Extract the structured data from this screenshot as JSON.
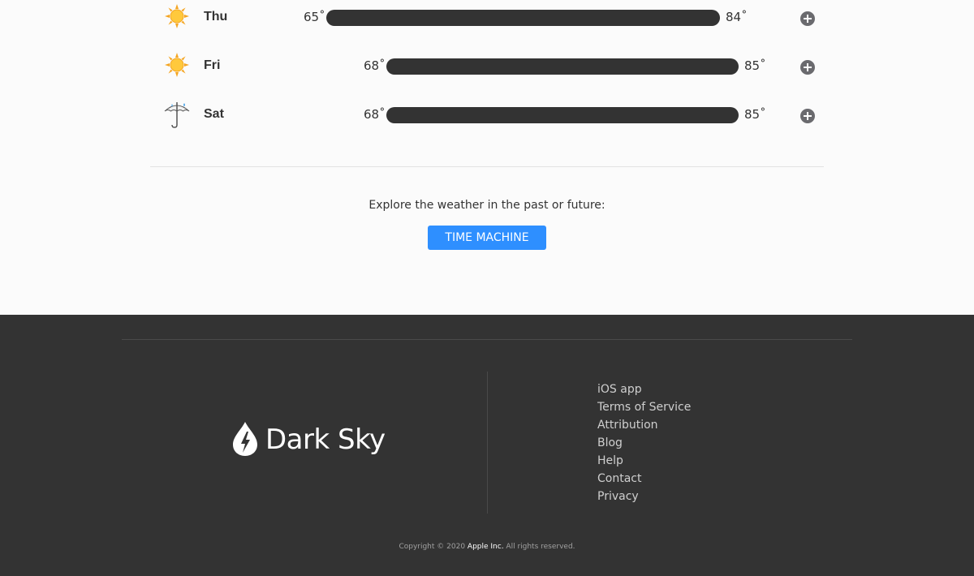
{
  "forecast": {
    "days": [
      {
        "day": "Thu",
        "icon": "sun-icon",
        "low": "65˚",
        "high": "84˚",
        "low_value": 65,
        "high_value": 84
      },
      {
        "day": "Fri",
        "icon": "sun-icon",
        "low": "68˚",
        "high": "85˚",
        "low_value": 68,
        "high_value": 85
      },
      {
        "day": "Sat",
        "icon": "umbrella-rain-icon",
        "low": "68˚",
        "high": "85˚",
        "low_value": 68,
        "high_value": 85
      }
    ]
  },
  "explore": {
    "text": "Explore the weather in the past or future:",
    "button_label": "TIME MACHINE",
    "button_color": "#2e8fff"
  },
  "footer": {
    "logo_text": "Dark Sky",
    "links": [
      "iOS app",
      "Terms of Service",
      "Attribution",
      "Blog",
      "Help",
      "Contact",
      "Privacy"
    ],
    "copyright_prefix": "Copyright © 2020 ",
    "copyright_company": "Apple Inc.",
    "copyright_suffix": " All rights reserved.",
    "background_color": "#333333"
  }
}
